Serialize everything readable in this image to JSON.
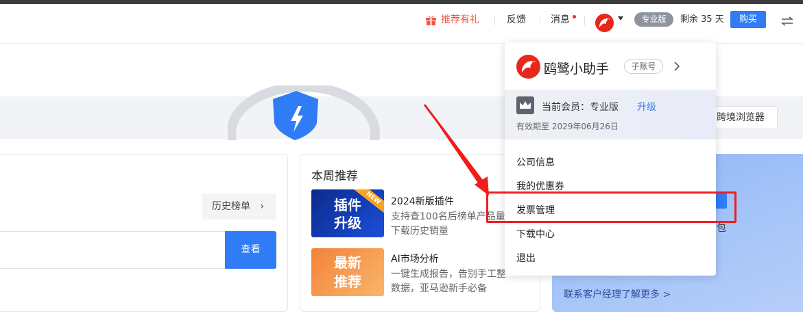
{
  "header": {
    "referral_label": "推荐有礼",
    "feedback_label": "反馈",
    "messages_label": "消息",
    "plan_badge": "专业版",
    "remaining_label": "剩余 35 天",
    "buy_label": "购买",
    "icons": [
      "gift-icon",
      "brand-logo",
      "caret-down-icon",
      "switch-icon"
    ]
  },
  "banner": {
    "browser_button": "跨境浏览器"
  },
  "left_card": {
    "history_button": "历史榜单",
    "view_button": "查看"
  },
  "weekly": {
    "title": "本周推荐",
    "items": [
      {
        "thumb_line1": "插件",
        "thumb_line2": "升级",
        "ribbon": "NEW",
        "title": "2024新版插件",
        "desc": "支持查100名后榜单产品量下载历史销量"
      },
      {
        "thumb_line1": "最新",
        "thumb_line2": "推荐",
        "title": "AI市场分析",
        "desc": "一键生成报告，告别手工整数据，亚马逊新手必备"
      }
    ]
  },
  "right_card": {
    "partial_text": "包",
    "link": "联系客户经理了解更多 >"
  },
  "dropdown": {
    "account_name": "鸥鹭小助手",
    "account_badge": "子账号",
    "member_label": "当前会员：专业版",
    "upgrade_label": "升级",
    "expire_label": "有效期至 2029年06月26日",
    "items": [
      "公司信息",
      "我的优惠券",
      "发票管理",
      "下载中心",
      "退出"
    ]
  },
  "colors": {
    "accent": "#2f7cf6",
    "referral": "#f5533d",
    "highlight_red": "#f21c1c",
    "brand_red": "#e8261c"
  }
}
